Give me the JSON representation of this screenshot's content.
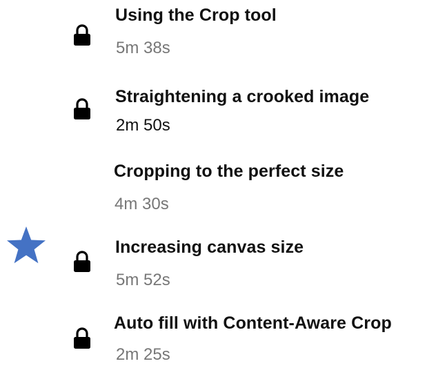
{
  "lessons": [
    {
      "title": "Using the Crop tool",
      "duration": "5m 38s",
      "locked": true,
      "icon": "lock-icon"
    },
    {
      "title": "Straightening a crooked image",
      "duration": "2m 50s",
      "locked": true,
      "icon": "lock-icon"
    },
    {
      "title": "Cropping to the perfect size",
      "duration": "4m 30s",
      "locked": false
    },
    {
      "title": "Increasing canvas size",
      "duration": "5m 52s",
      "locked": true,
      "icon": "lock-icon",
      "marked": true,
      "marker_icon": "star-icon"
    },
    {
      "title": "Auto fill with Content-Aware Crop",
      "duration": "2m 25s",
      "locked": true,
      "icon": "lock-icon"
    }
  ],
  "colors": {
    "title": "#111111",
    "duration": "#777777",
    "lock": "#000000",
    "star": "#4472C4"
  }
}
